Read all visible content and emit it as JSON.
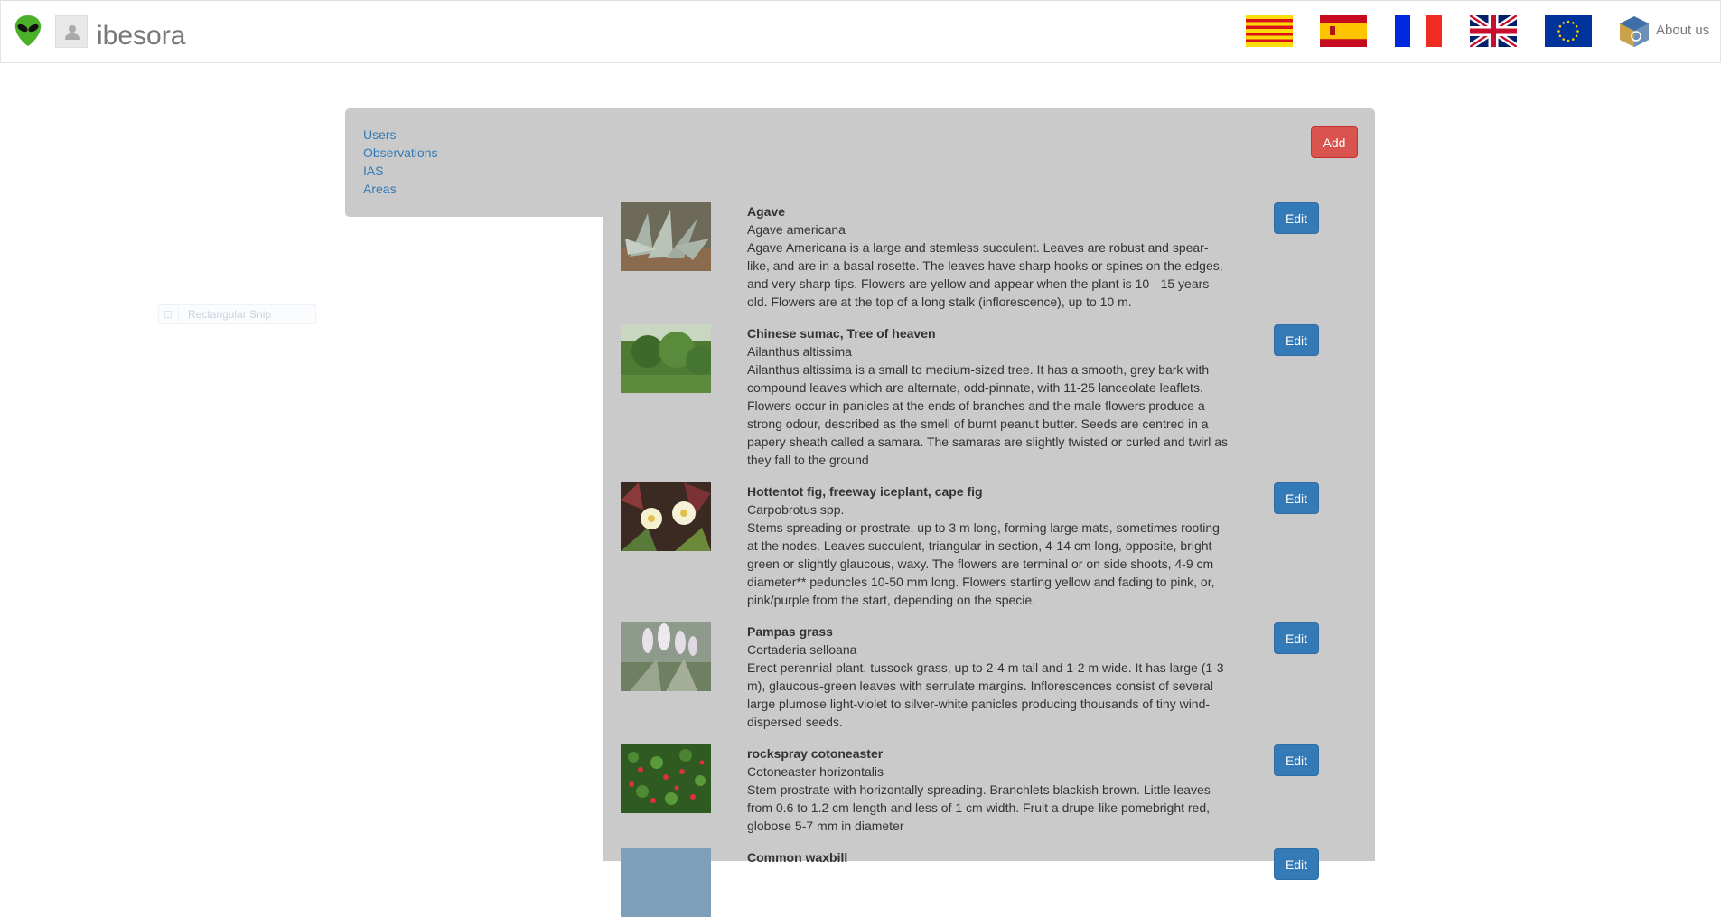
{
  "brand": {
    "name": "ibesora"
  },
  "nav": {
    "flags": [
      "catalan-flag",
      "spanish-flag",
      "french-flag",
      "uk-flag",
      "eu-flag"
    ],
    "about_label": "About us"
  },
  "sidebar": {
    "items": [
      {
        "label": "Users"
      },
      {
        "label": "Observations"
      },
      {
        "label": "IAS"
      },
      {
        "label": "Areas"
      }
    ]
  },
  "overlay": {
    "snip_label": "Rectangular Snip"
  },
  "main": {
    "add_label": "Add",
    "edit_label": "Edit",
    "items": [
      {
        "name": "Agave",
        "latin": "Agave americana",
        "description": "Agave Americana is a large and stemless succulent. Leaves are robust and spear-like, and are in a basal rosette. The leaves have sharp hooks or spines on the edges, and very sharp tips. Flowers are yellow and appear when the plant is 10 - 15 years old. Flowers are at the top of a long stalk (inflorescence), up to 10 m."
      },
      {
        "name": "Chinese sumac, Tree of heaven",
        "latin": "Ailanthus altissima",
        "description": "Ailanthus altissima is a small to medium-sized tree. It has a smooth, grey bark with compound leaves which are alternate, odd-pinnate, with 11-25 lanceolate leaflets. Flowers occur in panicles at the ends of branches and the male flowers produce a strong odour, described as the smell of burnt peanut butter. Seeds are centred in a papery sheath called a samara. The samaras are slightly twisted or curled and twirl as they fall to the ground"
      },
      {
        "name": "Hottentot fig, freeway iceplant, cape fig",
        "latin": "Carpobrotus spp.",
        "description": "Stems spreading or prostrate, up to 3 m long, forming large mats, sometimes rooting at the nodes. Leaves succulent, triangular in section, 4-14 cm long, opposite, bright green or slightly glaucous, waxy. The flowers are terminal or on side shoots, 4-9 cm diameter** peduncles 10-50 mm long. Flowers starting yellow and fading to pink, or, pink/purple from the start, depending on the specie."
      },
      {
        "name": "Pampas grass",
        "latin": "Cortaderia selloana",
        "description": "Erect perennial plant, tussock grass, up to 2-4 m tall and 1-2 m wide. It has large (1-3 m), glaucous-green leaves with serrulate margins. Inflorescences consist of several large plumose light-violet to silver-white panicles producing thousands of tiny wind-dispersed seeds."
      },
      {
        "name": "rockspray cotoneaster",
        "latin": "Cotoneaster horizontalis",
        "description": "Stem prostrate with horizontally spreading. Branchlets blackish brown. Little leaves from 0.6 to 1.2 cm length and less of 1 cm width. Fruit a drupe-like pomebright red, globose 5-7 mm in diameter"
      },
      {
        "name": "Common waxbill",
        "latin": "",
        "description": ""
      }
    ]
  }
}
